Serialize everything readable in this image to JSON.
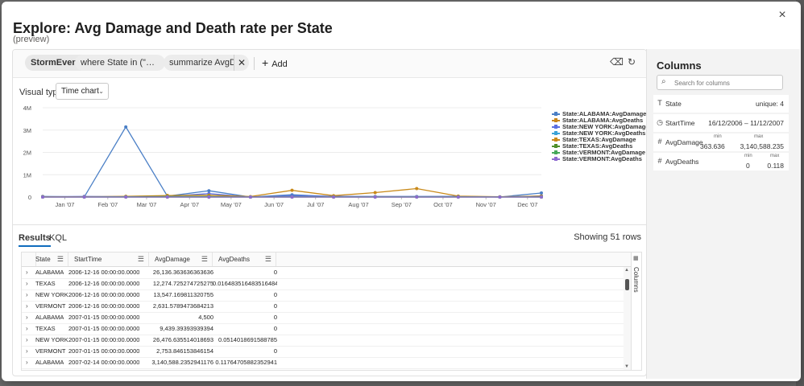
{
  "dialog": {
    "title": "Explore: Avg Damage and Death rate per State",
    "subtitle": "(preview)",
    "close_icon": "×"
  },
  "query": {
    "table": "StormEvents",
    "where": "where State in (\"VERMON...",
    "summarize": "summarize AvgDam...",
    "add_label": "Add"
  },
  "visual": {
    "label": "Visual type",
    "selected": "Time chart"
  },
  "tabs": {
    "results": "Results",
    "kql": "KQL"
  },
  "row_count": "Showing 51 rows",
  "grid": {
    "headers": [
      "State",
      "StartTime",
      "AvgDamage",
      "AvgDeaths"
    ],
    "side_label": "Columns",
    "rows": [
      [
        "ALABAMA",
        "2006-12-16 00:00:00.0000",
        "26,136.363636363636",
        "0"
      ],
      [
        "TEXAS",
        "2006-12-16 00:00:00.0000",
        "12,274.725274725275",
        "0.016483516483516484"
      ],
      [
        "NEW YORK",
        "2006-12-16 00:00:00.0000",
        "13,547.169811320755",
        "0"
      ],
      [
        "VERMONT",
        "2006-12-16 00:00:00.0000",
        "2,631.5789473684213",
        "0"
      ],
      [
        "ALABAMA",
        "2007-01-15 00:00:00.0000",
        "4,500",
        "0"
      ],
      [
        "TEXAS",
        "2007-01-15 00:00:00.0000",
        "9,439.39393939394",
        "0"
      ],
      [
        "NEW YORK",
        "2007-01-15 00:00:00.0000",
        "26,476.635514018693",
        "0.0514018691588785"
      ],
      [
        "VERMONT",
        "2007-01-15 00:00:00.0000",
        "2,753.846153846154",
        "0"
      ],
      [
        "ALABAMA",
        "2007-02-14 00:00:00.0000",
        "3,140,588.2352941176",
        "0.11764705882352941"
      ]
    ]
  },
  "columns_panel": {
    "title": "Columns",
    "search_placeholder": "Search for columns",
    "items": [
      {
        "icon": "T",
        "name": "State",
        "summary": "unique: 4"
      },
      {
        "icon": "◷",
        "name": "StartTime",
        "summary": "16/12/2006 – 11/12/2007"
      },
      {
        "icon": "#",
        "name": "AvgDamage",
        "min_label": "min",
        "max_label": "max",
        "min": "363.636",
        "max": "3,140,588.235"
      },
      {
        "icon": "#",
        "name": "AvgDeaths",
        "min_label": "min",
        "max_label": "max",
        "min": "0",
        "max": "0.118"
      }
    ]
  },
  "chart_data": {
    "type": "line",
    "title": "",
    "xlabel": "",
    "ylabel": "",
    "y_tick_labels": [
      "0",
      "1M",
      "2M",
      "3M",
      "4M"
    ],
    "y_ticks": [
      0,
      1000000,
      2000000,
      3000000,
      4000000
    ],
    "ylim": [
      0,
      4000000
    ],
    "x_tick_labels": [
      "Jan '07",
      "Feb '07",
      "Mar '07",
      "Apr '07",
      "May '07",
      "Jun '07",
      "Jul '07",
      "Aug '07",
      "Sep '07",
      "Oct '07",
      "Nov '07",
      "Dec '07"
    ],
    "x": [
      "2006-12-16",
      "2007-01-15",
      "2007-02-14",
      "2007-03-16",
      "2007-04-15",
      "2007-05-15",
      "2007-06-14",
      "2007-07-14",
      "2007-08-13",
      "2007-09-12",
      "2007-10-12",
      "2007-11-11",
      "2007-12-11"
    ],
    "legend_position": "right",
    "series": [
      {
        "name": "State:ALABAMA:AvgDamage",
        "color": "#4a7fc6",
        "values": [
          26136,
          4500,
          3140588,
          40000,
          280000,
          0,
          100000,
          20000,
          20000,
          20000,
          30000,
          0,
          180000
        ]
      },
      {
        "name": "State:ALABAMA:AvgDeaths",
        "color": "#c9861a",
        "values": [
          0,
          0,
          0.118,
          0,
          0,
          0,
          0,
          0,
          0,
          0,
          0,
          0,
          0
        ]
      },
      {
        "name": "State:NEW YORK:AvgDamage",
        "color": "#5b6fe0",
        "values": [
          13547,
          26476,
          20000,
          30000,
          150000,
          0,
          50000,
          30000,
          20000,
          20000,
          20000,
          0,
          50000
        ]
      },
      {
        "name": "State:NEW YORK:AvgDeaths",
        "color": "#3aa3d8",
        "values": [
          0,
          0.051,
          0,
          0,
          0,
          0,
          0,
          0,
          0,
          0,
          0,
          0,
          0
        ]
      },
      {
        "name": "State:TEXAS:AvgDamage",
        "color": "#c98a1a",
        "values": [
          12274,
          9439,
          30000,
          70000,
          80000,
          20000,
          300000,
          60000,
          200000,
          380000,
          40000,
          10000,
          40000
        ]
      },
      {
        "name": "State:TEXAS:AvgDeaths",
        "color": "#4f8f2a",
        "values": [
          0.016,
          0,
          0,
          0,
          0,
          0,
          0,
          0,
          0,
          0,
          0,
          0,
          0
        ]
      },
      {
        "name": "State:VERMONT:AvgDamage",
        "color": "#46a85a",
        "values": [
          2631,
          2753,
          10000,
          20000,
          20000,
          5000,
          10000,
          10000,
          10000,
          10000,
          10000,
          5000,
          10000
        ]
      },
      {
        "name": "State:VERMONT:AvgDeaths",
        "color": "#8e6bd0",
        "values": [
          0,
          0,
          0,
          0,
          0,
          0,
          0,
          0,
          0,
          0,
          0,
          0,
          0
        ]
      }
    ]
  }
}
